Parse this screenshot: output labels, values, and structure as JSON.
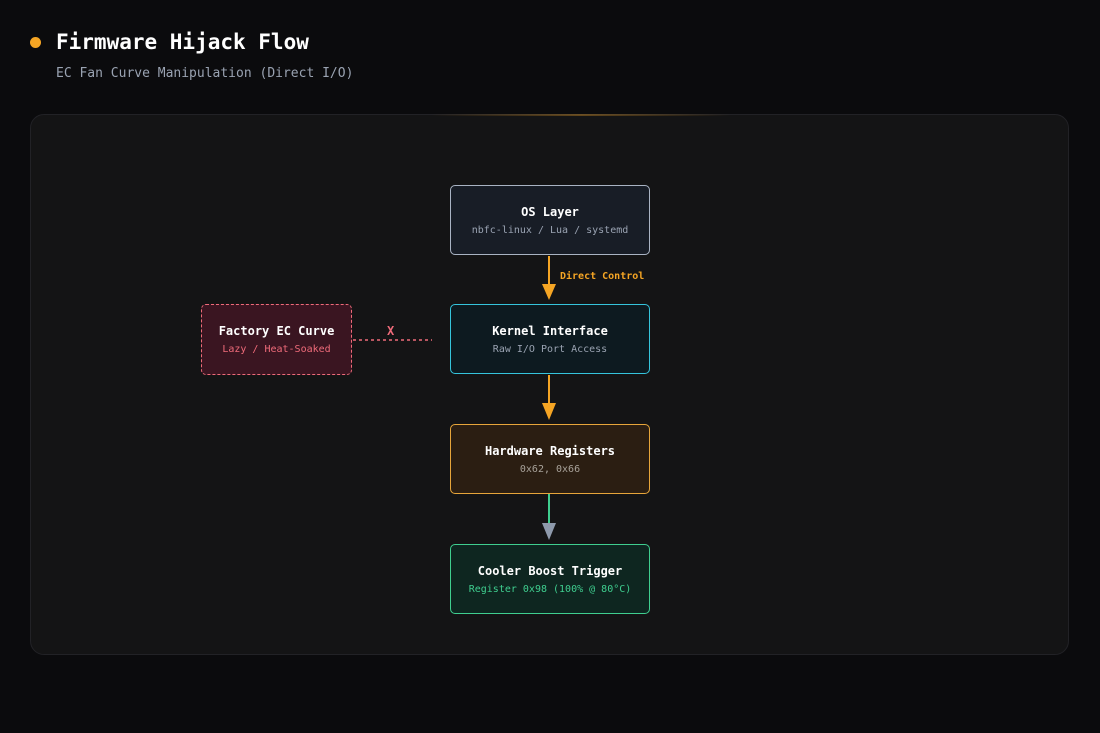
{
  "header": {
    "title": "Firmware Hijack Flow",
    "subtitle": "EC Fan Curve Manipulation (Direct I/O)"
  },
  "nodes": {
    "os": {
      "title": "OS Layer",
      "sub": "nbfc-linux / Lua / systemd"
    },
    "kernel": {
      "title": "Kernel Interface",
      "sub": "Raw I/O Port Access"
    },
    "hardware": {
      "title": "Hardware Registers",
      "sub": "0x62, 0x66"
    },
    "boost": {
      "title": "Cooler Boost Trigger",
      "sub": "Register 0x98 (100% @ 80°C)"
    },
    "factory": {
      "title": "Factory EC Curve",
      "sub": "Lazy / Heat-Soaked"
    }
  },
  "edges": {
    "direct_label": "Direct Control",
    "blocked_label": "X"
  },
  "colors": {
    "accent": "#f5a524",
    "os_border": "#a9b3c3",
    "kernel_border": "#35c4dc",
    "hardware_border": "#e7a53a",
    "boost_border": "#3fce8f",
    "factory_border": "#ef6b7a",
    "final_edge": "#8e9aac"
  }
}
